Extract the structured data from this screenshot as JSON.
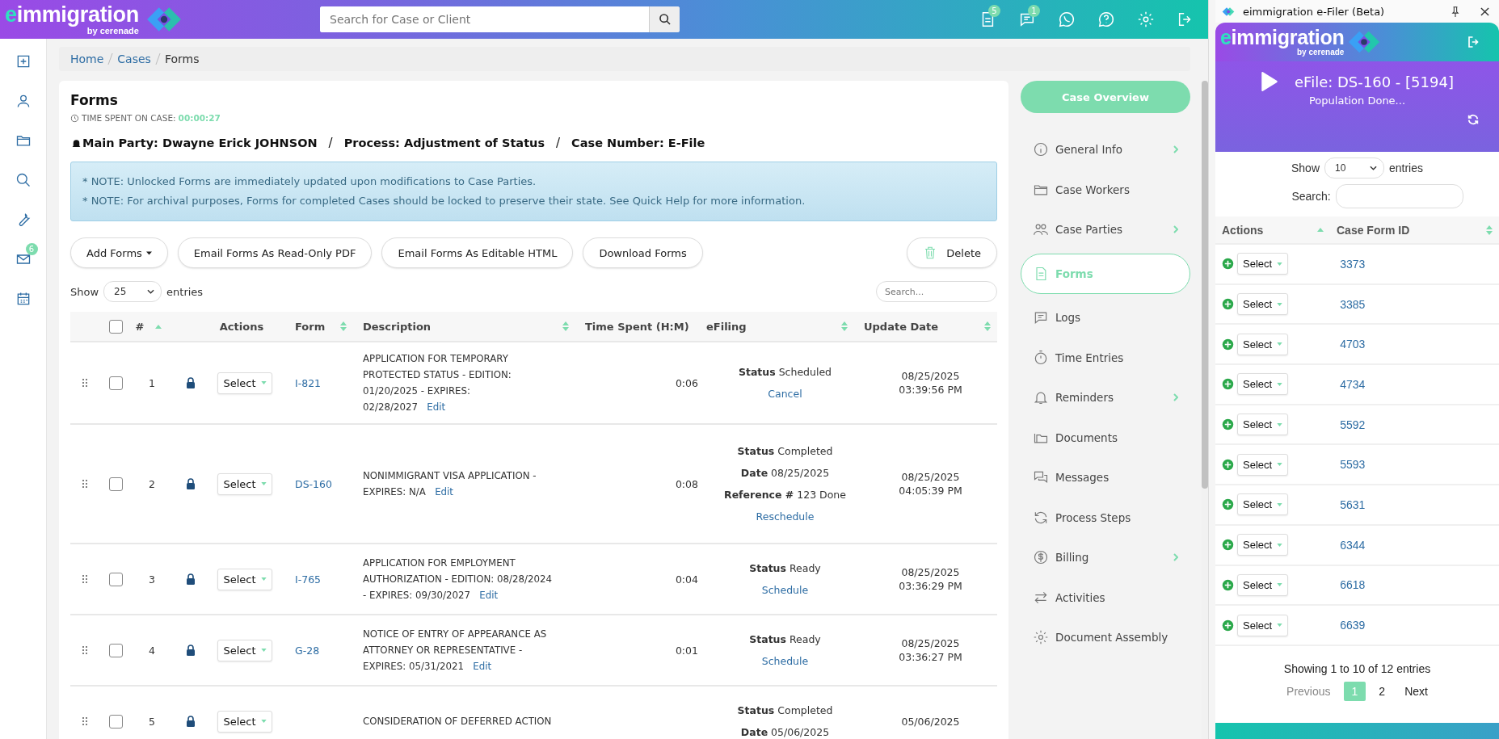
{
  "topbar": {
    "logo": "eimmigration",
    "logo_sub": "by cerenade",
    "search": {
      "placeholder": "Search for Case or Client"
    },
    "icons": [
      {
        "kind": "document",
        "badge": "5"
      },
      {
        "kind": "chat",
        "badge": "1"
      },
      {
        "kind": "phone-bubble"
      },
      {
        "kind": "question-bubble"
      },
      {
        "kind": "gear"
      },
      {
        "kind": "logout"
      }
    ]
  },
  "rail": [
    {
      "kind": "plus-square"
    },
    {
      "kind": "user"
    },
    {
      "kind": "folder"
    },
    {
      "kind": "search"
    },
    {
      "kind": "wrench"
    },
    {
      "kind": "envelope",
      "badge": "6"
    },
    {
      "kind": "calendar"
    }
  ],
  "breadcrumb": [
    "Home",
    "Cases",
    "Forms"
  ],
  "forms": {
    "title": "Forms",
    "time_label": "TIME SPENT ON CASE:",
    "time_value": "00:00:27",
    "case_line": [
      {
        "kind": "field",
        "text": "Main Party: Dwayne Erick JOHNSON"
      },
      {
        "kind": "separator",
        "text": "/"
      },
      {
        "kind": "field",
        "text": "Process: Adjustment of Status"
      },
      {
        "kind": "separator",
        "text": "/"
      },
      {
        "kind": "field",
        "text": "Case Number: E-File"
      }
    ],
    "notes": [
      "* NOTE: Unlocked Forms are immediately updated upon modifications to Case Parties.",
      "* NOTE: For archival purposes, Forms for completed Cases should be locked to preserve their state. See Quick Help for more information."
    ],
    "buttons": [
      {
        "kind": "dropdown",
        "label": "Add Forms"
      },
      {
        "kind": "plain",
        "label": "Email Forms As Read-Only PDF"
      },
      {
        "kind": "plain",
        "label": "Email Forms As Editable HTML"
      },
      {
        "kind": "plain",
        "label": "Download Forms"
      },
      {
        "kind": "delete",
        "label": "Delete"
      }
    ],
    "show_label": "Show",
    "show_value": "25",
    "entries_label": "entries",
    "search": {
      "placeholder": "Search..."
    },
    "columns": [
      "#",
      "Actions",
      "Form",
      "Description",
      "Time Spent (H:M)",
      "eFiling",
      "Update Date"
    ],
    "header_checked": false,
    "rows": [
      {
        "checked": false,
        "num": "1",
        "action": "Select",
        "form": "I-821",
        "description": "APPLICATION FOR TEMPORARY PROTECTED STATUS - EDITION: 01/20/2025 - EXPIRES: 02/28/2027",
        "edit": "Edit",
        "time": "0:06",
        "efiling": [
          {
            "label": "Status",
            "value": "Scheduled"
          }
        ],
        "efiling_link": "Cancel",
        "updated": "08/25/2025 03:39:56 PM"
      },
      {
        "checked": false,
        "num": "2",
        "action": "Select",
        "form": "DS-160",
        "description": "NONIMMIGRANT VISA APPLICATION - EXPIRES: N/A",
        "edit": "Edit",
        "time": "0:08",
        "efiling": [
          {
            "label": "Status",
            "value": "Completed"
          },
          {
            "label": "Date",
            "value": "08/25/2025"
          },
          {
            "label": "Reference #",
            "value": "123 Done"
          }
        ],
        "efiling_link": "Reschedule",
        "updated": "08/25/2025 04:05:39 PM"
      },
      {
        "checked": false,
        "num": "3",
        "action": "Select",
        "form": "I-765",
        "description": "APPLICATION FOR EMPLOYMENT AUTHORIZATION - EDITION: 08/28/2024 - EXPIRES: 09/30/2027",
        "edit": "Edit",
        "time": "0:04",
        "efiling": [
          {
            "label": "Status",
            "value": "Ready"
          }
        ],
        "efiling_link": "Schedule",
        "updated": "08/25/2025 03:36:29 PM"
      },
      {
        "checked": false,
        "num": "4",
        "action": "Select",
        "form": "G-28",
        "description": "NOTICE OF ENTRY OF APPEARANCE AS ATTORNEY OR REPRESENTATIVE - EXPIRES: 05/31/2021",
        "edit": "Edit",
        "time": "0:01",
        "efiling": [
          {
            "label": "Status",
            "value": "Ready"
          }
        ],
        "efiling_link": "Schedule",
        "updated": "08/25/2025 03:36:27 PM"
      },
      {
        "checked": false,
        "num": "5",
        "action": "Select",
        "form": "",
        "description": "CONSIDERATION OF DEFERRED ACTION",
        "edit": "",
        "time": "",
        "efiling": [
          {
            "label": "Status",
            "value": "Completed"
          },
          {
            "label": "Date",
            "value": "05/06/2025"
          }
        ],
        "efiling_link": "",
        "updated": "05/06/2025"
      }
    ]
  },
  "case_nav": {
    "overview": "Case Overview",
    "items": [
      {
        "kind": "info",
        "label": "General Info",
        "arrow": true,
        "selected": false
      },
      {
        "kind": "folder",
        "label": "Case Workers",
        "arrow": false,
        "selected": false
      },
      {
        "kind": "people",
        "label": "Case Parties",
        "arrow": true,
        "selected": false
      },
      {
        "kind": "document",
        "label": "Forms",
        "arrow": false,
        "selected": true
      },
      {
        "kind": "chat",
        "label": "Logs",
        "arrow": false,
        "selected": false
      },
      {
        "kind": "stopwatch",
        "label": "Time Entries",
        "arrow": false,
        "selected": false
      },
      {
        "kind": "bell",
        "label": "Reminders",
        "arrow": true,
        "selected": false
      },
      {
        "kind": "folders",
        "label": "Documents",
        "arrow": false,
        "selected": false
      },
      {
        "kind": "chats",
        "label": "Messages",
        "arrow": false,
        "selected": false
      },
      {
        "kind": "refresh",
        "label": "Process Steps",
        "arrow": false,
        "selected": false
      },
      {
        "kind": "dollar",
        "label": "Billing",
        "arrow": true,
        "selected": false
      },
      {
        "kind": "arrows",
        "label": "Activities",
        "arrow": false,
        "selected": false
      },
      {
        "kind": "gear",
        "label": "Document Assembly",
        "arrow": false,
        "selected": false
      }
    ]
  },
  "efiler": {
    "title": "eimmigration e-Filer (Beta)",
    "logo": "eimmigration",
    "logo_sub": "by cerenade",
    "job": "eFile: DS-160 - [5194]",
    "status": "Population Done...",
    "show_label": "Show",
    "show_value": "10",
    "entries_label": "entries",
    "search_label": "Search:",
    "columns": [
      "Actions",
      "Case Form ID"
    ],
    "rows": [
      {
        "action": "Select",
        "id": "3373"
      },
      {
        "action": "Select",
        "id": "3385"
      },
      {
        "action": "Select",
        "id": "4703"
      },
      {
        "action": "Select",
        "id": "4734"
      },
      {
        "action": "Select",
        "id": "5592"
      },
      {
        "action": "Select",
        "id": "5593"
      },
      {
        "action": "Select",
        "id": "5631"
      },
      {
        "action": "Select",
        "id": "6344"
      },
      {
        "action": "Select",
        "id": "6618"
      },
      {
        "action": "Select",
        "id": "6639"
      }
    ],
    "info": "Showing 1 to 10 of 12 entries",
    "pages": [
      {
        "label": "Previous",
        "disabled": true,
        "selected": false
      },
      {
        "label": "1",
        "disabled": false,
        "selected": true
      },
      {
        "label": "2",
        "disabled": false,
        "selected": false
      },
      {
        "label": "Next",
        "disabled": false,
        "selected": false
      }
    ]
  }
}
